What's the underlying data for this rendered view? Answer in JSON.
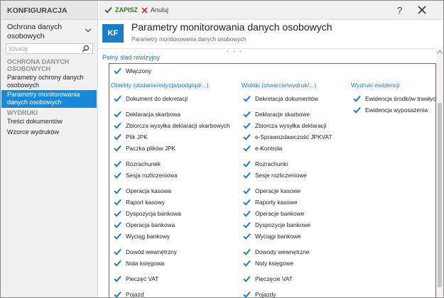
{
  "sidebar": {
    "header": "KONFIGURACJA",
    "module": "Ochrona danych osobowych",
    "search_placeholder": "Szukaj",
    "groups": [
      {
        "label": "OCHRONA DANYCH OSOBOWYCH",
        "items": [
          {
            "label": "Parametry ochrony danych osobowych",
            "active": false
          },
          {
            "label": "Parametry monitorowania danych osobowych",
            "active": true
          }
        ]
      },
      {
        "label": "WYDRUKI",
        "items": [
          {
            "label": "Treści dokumentów",
            "active": false
          },
          {
            "label": "Wzorce wydruków",
            "active": false
          }
        ]
      }
    ]
  },
  "toolbar": {
    "save_label": "ZAPISZ",
    "cancel_label": "Anuluj",
    "help_label": "?"
  },
  "header": {
    "icon_text": "KF",
    "title": "Parametry monitorowania danych osobowych",
    "subtitle": "Parametry monitorowania danych osobowych"
  },
  "section": {
    "label": "Pełny ślad rewizyjny"
  },
  "enabled": {
    "label": "Włączony",
    "checked": true
  },
  "columns": [
    {
      "header": "Obiekty (dodanie/edycja/podgląd/...)",
      "items": [
        "Dokument do dekretacji",
        "Deklaracja skarbowa",
        "Zbiorcza wysyłka deklaracji skarbowych",
        "Plik JPK",
        "Paczka plików JPK",
        "Rozrachunek",
        "Sesja rozliczeniowa",
        "Operacja kasowa",
        "Raport kasowy",
        "Dyspozycja bankowa",
        "Operacja bankowa",
        "Wyciąg bankowy",
        "Dowód wewnętrzny",
        "Nota księgowa",
        "Pieczęć VAT",
        "Pojazd"
      ]
    },
    {
      "header": "Widoki (otwarcie/wydruk/...)",
      "items": [
        "Dekretacja dokumentów",
        "Deklaracje skarbowe",
        "Zbiorcza wysyłka deklaracji",
        "e-Sprawozdawczość JPKVAT",
        "e-Kontrola",
        "Rozrachunki",
        "Sesje rozliczeniowe",
        "Operacje kasowe",
        "Raporty kasowe",
        "Operacje bankowe",
        "Dyspozycje bankowe",
        "Wyciągi bankowe",
        "Dowody wewnętrzne",
        "Noty księgowe",
        "Pieczęcie VAT",
        "Pojazdy"
      ]
    },
    {
      "header": "Wydruki ewidencji",
      "items": [
        "Ewidencja środków trwałych",
        "Ewidencja wyposażenia"
      ]
    }
  ],
  "colors": {
    "accent": "#1a88d8",
    "check": "#1a7dc6",
    "highlight_border": "#e23a3a",
    "save": "#2f7d1f",
    "cancel": "#e03030"
  },
  "icons": {
    "save": "checkmark-icon",
    "cancel": "x-icon",
    "close": "close-icon",
    "search": "magnifier-icon",
    "module_dropdown": "chevron-down-icon"
  }
}
